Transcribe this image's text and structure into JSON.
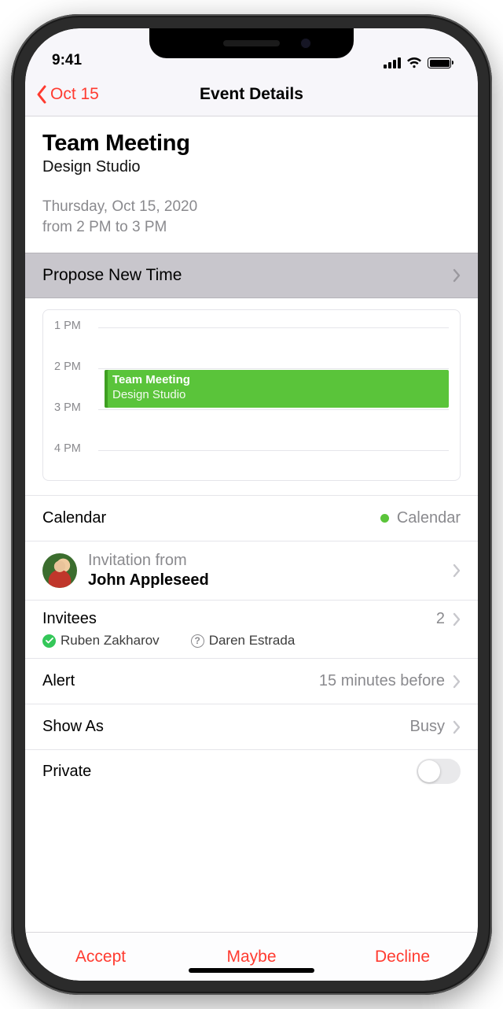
{
  "statusbar": {
    "time": "9:41"
  },
  "nav": {
    "back_label": "Oct 15",
    "title": "Event Details"
  },
  "event": {
    "title": "Team Meeting",
    "location": "Design Studio",
    "date_line": "Thursday, Oct 15, 2020",
    "time_line": "from 2 PM to 3 PM"
  },
  "propose_label": "Propose New Time",
  "timeline": {
    "hour1": "1 PM",
    "hour2": "2 PM",
    "hour3": "3 PM",
    "hour4": "4 PM",
    "block_title": "Team Meeting",
    "block_subtitle": "Design Studio"
  },
  "calendar_row": {
    "label": "Calendar",
    "value": "Calendar"
  },
  "invitation": {
    "from_label": "Invitation from",
    "from_name": "John Appleseed"
  },
  "invitees": {
    "label": "Invitees",
    "count": "2",
    "person1": "Ruben Zakharov",
    "person2": "Daren Estrada"
  },
  "alert_row": {
    "label": "Alert",
    "value": "15 minutes before"
  },
  "showas_row": {
    "label": "Show As",
    "value": "Busy"
  },
  "private_row": {
    "label": "Private"
  },
  "toolbar": {
    "accept": "Accept",
    "maybe": "Maybe",
    "decline": "Decline"
  }
}
